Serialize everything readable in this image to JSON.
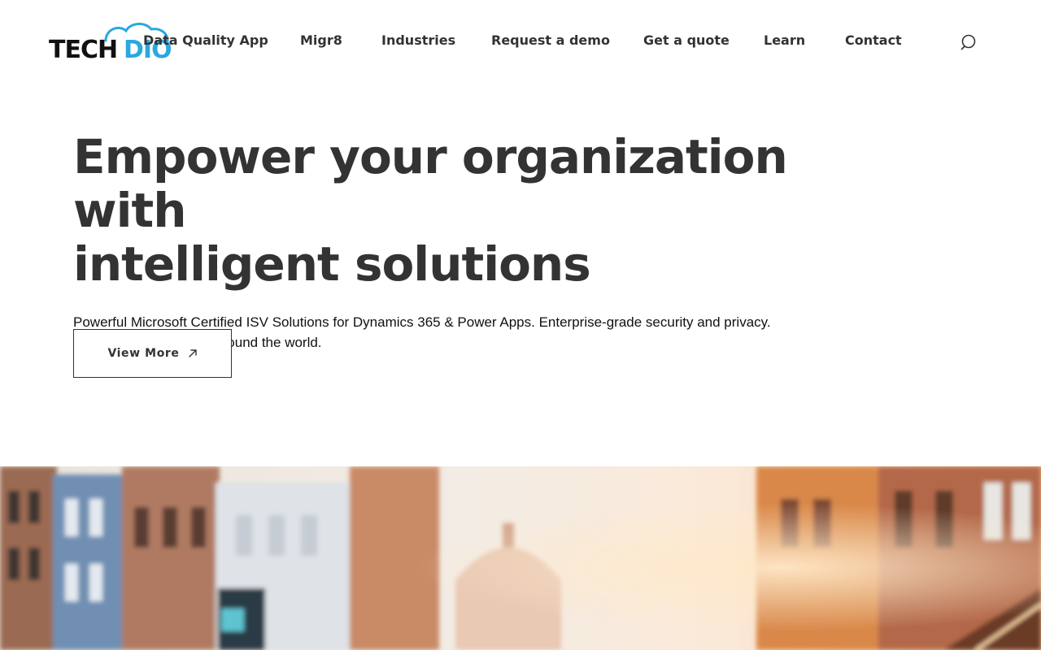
{
  "header": {
    "logo": {
      "text_dark": "TECH",
      "text_accent": "DIO",
      "accent_color": "#2aa8df"
    },
    "nav": [
      {
        "id": "data-quality-app",
        "label": "Data Quality App"
      },
      {
        "id": "migr8",
        "label": "Migr8"
      },
      {
        "id": "industries",
        "label": "Industries"
      },
      {
        "id": "request-a-demo",
        "label": "Request a demo"
      },
      {
        "id": "get-a-quote",
        "label": "Get a quote"
      },
      {
        "id": "learn",
        "label": "Learn"
      },
      {
        "id": "contact",
        "label": "Contact"
      }
    ],
    "search_icon": "search-icon"
  },
  "hero": {
    "title_line1": "Empower your organization with",
    "title_line2": "intelligent solutions",
    "subtitle_line1": "Powerful Microsoft Certified ISV Solutions for Dynamics 365 & Power Apps. Enterprise-grade security and privacy.",
    "subtitle_line2": "Trusted by businesses around the world.",
    "cta_label": "View More",
    "cta_icon": "arrow-up-right-icon"
  },
  "colors": {
    "text": "#333333",
    "accent": "#2aa8df",
    "background": "#ffffff"
  }
}
